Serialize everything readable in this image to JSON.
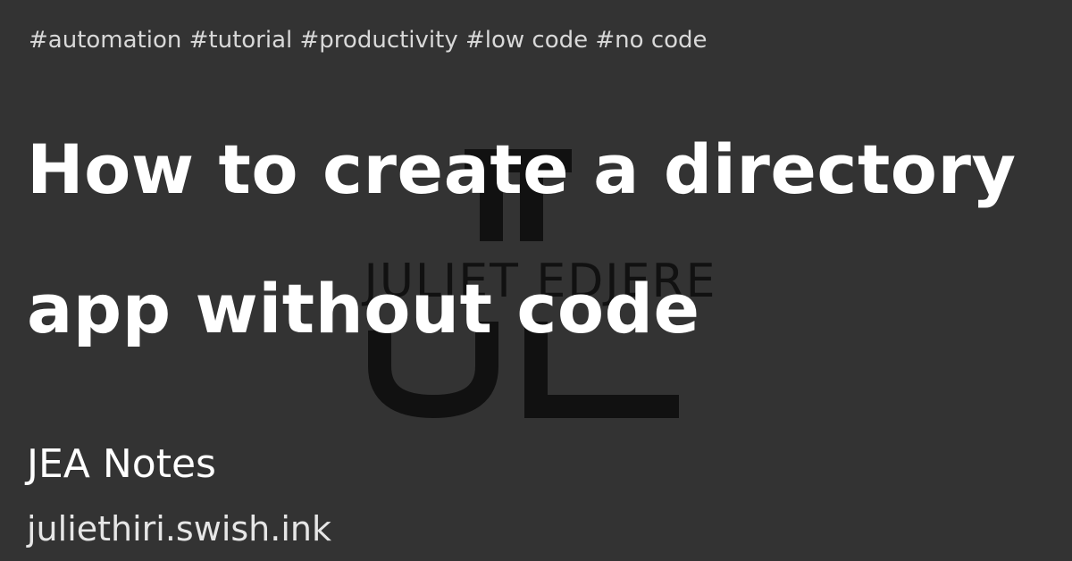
{
  "card": {
    "tags": "#automation #tutorial #productivity #low code #no code",
    "title": "How to create a directory app without code",
    "site_name": "JEA Notes",
    "site_url": "juliethiri.swish.ink"
  },
  "logo": {
    "wordmark": "JULIET EDJERE",
    "monogram": "JE",
    "color": "#111111"
  },
  "colors": {
    "background": "#333333",
    "text": "#ffffff"
  }
}
